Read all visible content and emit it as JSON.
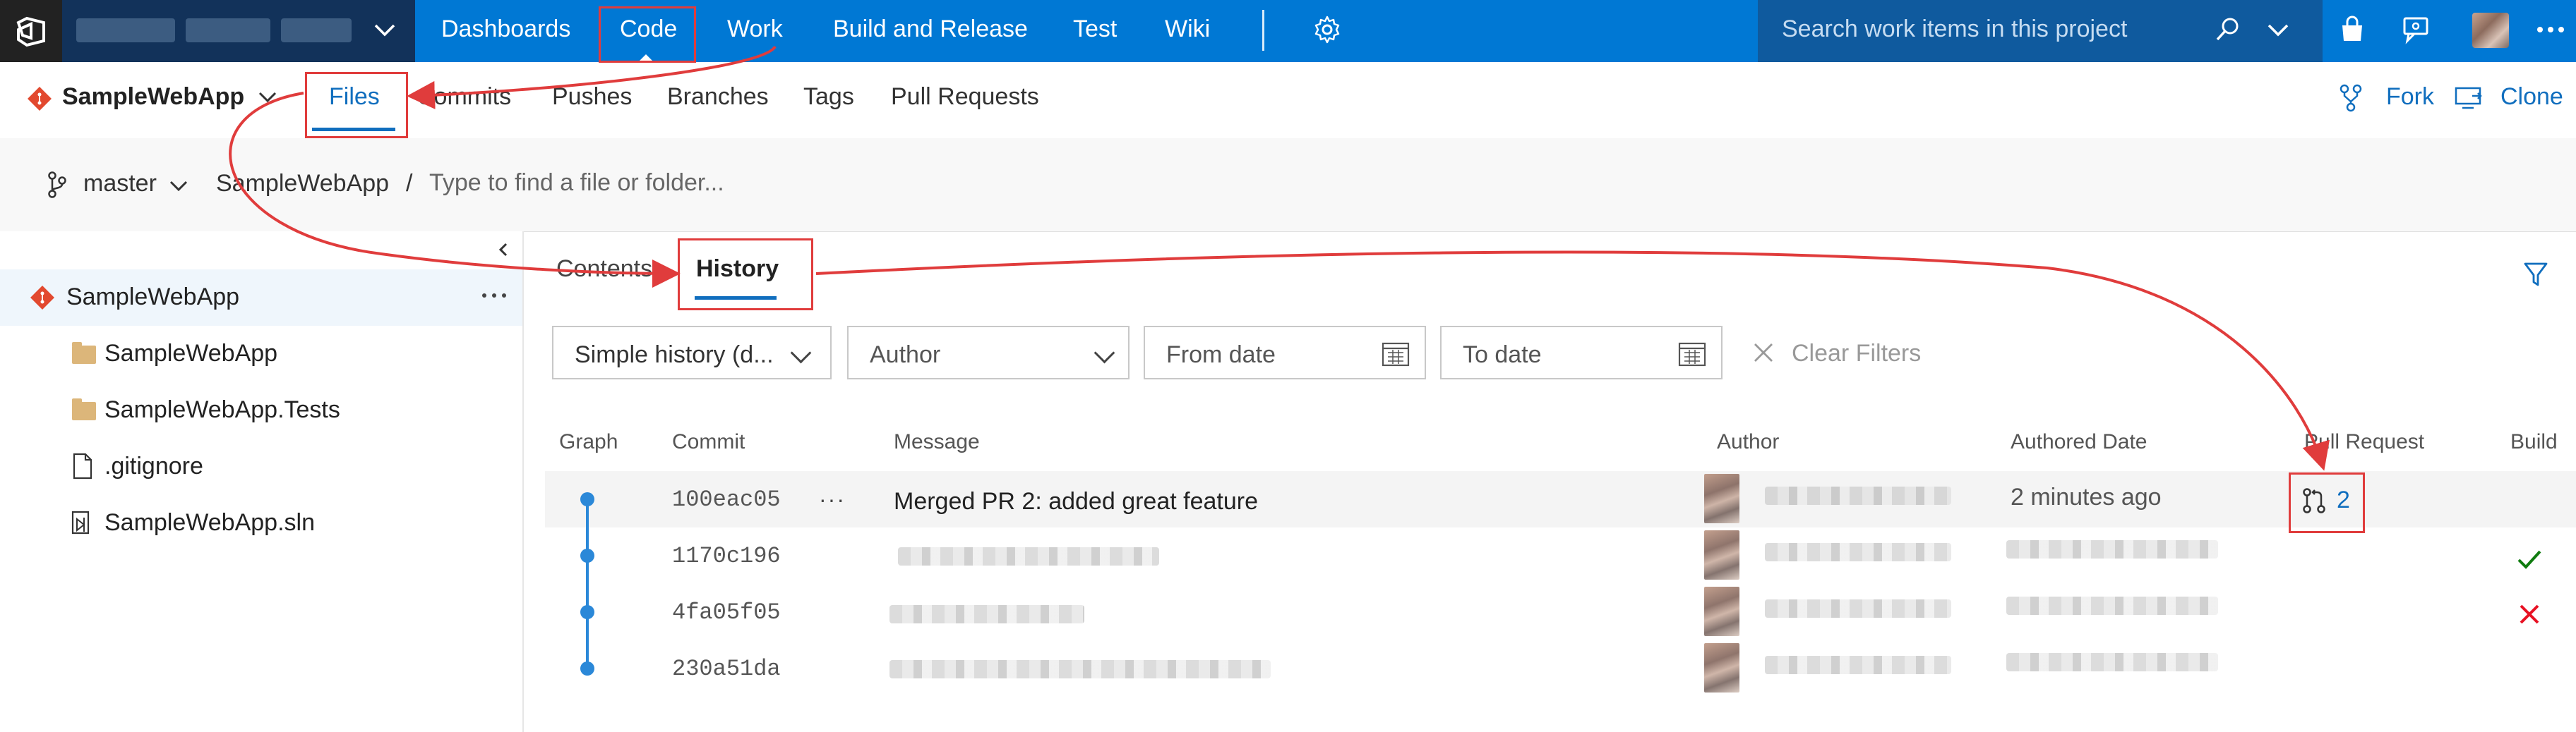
{
  "topbar": {
    "nav": [
      "Dashboards",
      "Code",
      "Work",
      "Build and Release",
      "Test",
      "Wiki"
    ],
    "search_placeholder": "Search work items in this project",
    "icons": [
      "vsts-logo-icon",
      "chevron-down-icon",
      "gear-icon",
      "search-icon",
      "chevron-down-icon",
      "shopping-bag-icon",
      "feedback-icon",
      "more-icon"
    ]
  },
  "repo_bar": {
    "repo_name": "SampleWebApp",
    "tabs": [
      "Files",
      "Commits",
      "Pushes",
      "Branches",
      "Tags",
      "Pull Requests"
    ],
    "active_tab": "Files",
    "fork_label": "Fork",
    "clone_label": "Clone"
  },
  "breadcrumb": {
    "branch": "master",
    "root": "SampleWebApp",
    "separator": "/",
    "path_placeholder": "Type to find a file or folder..."
  },
  "tree": {
    "root": "SampleWebApp",
    "items": [
      {
        "name": "SampleWebApp",
        "icon": "folder-icon"
      },
      {
        "name": "SampleWebApp.Tests",
        "icon": "folder-icon"
      },
      {
        "name": ".gitignore",
        "icon": "file-icon"
      },
      {
        "name": "SampleWebApp.sln",
        "icon": "solution-file-icon"
      }
    ]
  },
  "pivots": {
    "contents": "Contents",
    "history": "History",
    "active": "History"
  },
  "filters": {
    "history_mode": "Simple history (d...",
    "author_placeholder": "Author",
    "from_date_placeholder": "From date",
    "to_date_placeholder": "To date",
    "clear_label": "Clear Filters"
  },
  "columns": [
    "Graph",
    "Commit",
    "Message",
    "Author",
    "Authored Date",
    "Pull Request",
    "Build"
  ],
  "commits": [
    {
      "id": "100eac05",
      "message": "Merged PR 2: added great feature",
      "date": "2 minutes ago",
      "pull_request": "2",
      "build": ""
    },
    {
      "id": "1170c196",
      "message": "",
      "date": "",
      "pull_request": "",
      "build": "success"
    },
    {
      "id": "4fa05f05",
      "message": "",
      "date": "",
      "pull_request": "",
      "build": "failed"
    },
    {
      "id": "230a51da",
      "message": "",
      "date": "",
      "pull_request": "",
      "build": ""
    }
  ],
  "row_more": "···",
  "colors": {
    "accent": "#0078d4",
    "link": "#106ebe",
    "annotation": "#e03c3c",
    "success": "#107c10",
    "failure": "#e81123"
  }
}
